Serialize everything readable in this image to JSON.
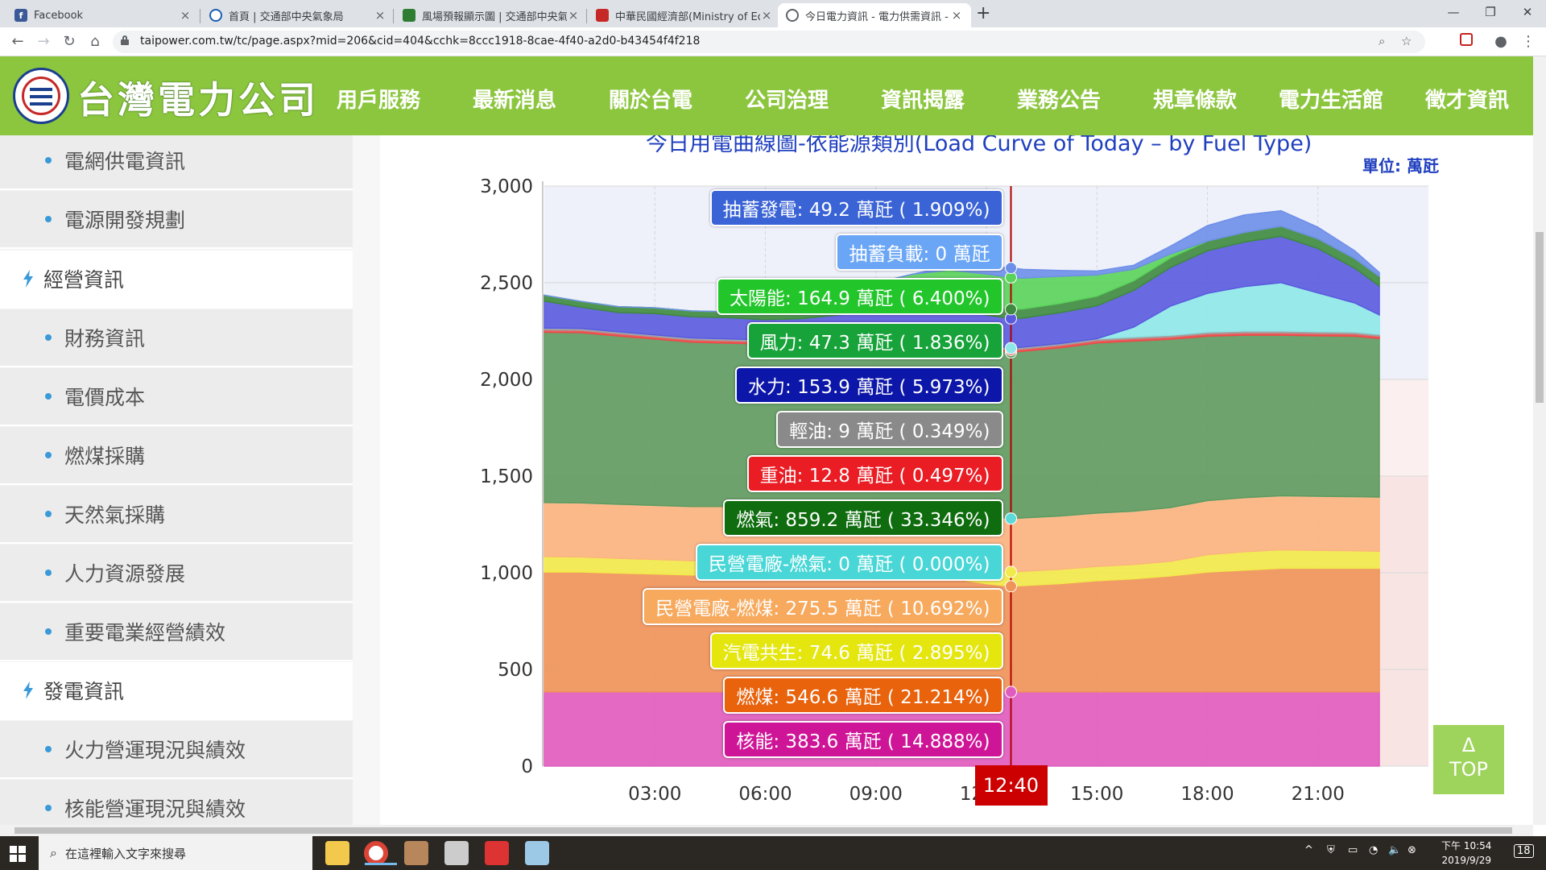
{
  "browser": {
    "tabs": [
      {
        "title": "Facebook",
        "icon": "facebook-icon",
        "color": "#3b5998"
      },
      {
        "title": "首頁 | 交通部中央氣象局",
        "icon": "eye-icon",
        "color": "#1a5fb4"
      },
      {
        "title": "風場預報顯示圖 | 交通部中央氣象",
        "icon": "weather-map-icon",
        "color": "#2e7d32"
      },
      {
        "title": "中華民國經濟部(Ministry of Econ",
        "icon": "moea-icon",
        "color": "#c62828"
      },
      {
        "title": "今日電力資訊 - 電力供需資訊 - 台",
        "icon": "site-icon",
        "color": "#5f6368"
      }
    ],
    "close_glyph": "×",
    "new_tab_glyph": "+",
    "url": "taipower.com.tw/tc/page.aspx?mid=206&cid=404&cchk=8ccc1918-8cae-4f40-a2d0-b43454f4f218"
  },
  "site": {
    "logo_text": "台灣電力公司",
    "nav": [
      "用戶服務",
      "最新消息",
      "關於台電",
      "公司治理",
      "資訊揭露",
      "業務公告",
      "規章條款",
      "電力生活館",
      "徵才資訊"
    ],
    "brand_color": "#8cc63f"
  },
  "sidebar": {
    "items": [
      {
        "label": "電網供電資訊",
        "kind": "sub"
      },
      {
        "label": "電源開發規劃",
        "kind": "sub"
      },
      {
        "label": "經營資訊",
        "kind": "cat"
      },
      {
        "label": "財務資訊",
        "kind": "sub"
      },
      {
        "label": "電價成本",
        "kind": "sub"
      },
      {
        "label": "燃煤採購",
        "kind": "sub"
      },
      {
        "label": "天然氣採購",
        "kind": "sub"
      },
      {
        "label": "人力資源發展",
        "kind": "sub"
      },
      {
        "label": "重要電業經營績效",
        "kind": "sub"
      },
      {
        "label": "發電資訊",
        "kind": "cat"
      },
      {
        "label": "火力營運現況與績效",
        "kind": "sub"
      },
      {
        "label": "核能營運現況與績效",
        "kind": "sub"
      }
    ]
  },
  "chart_data": {
    "type": "area",
    "title": "今日用電曲線圖-依能源類別(Load Curve of Today – by Fuel Type)",
    "unit": "單位: 萬瓩",
    "yticks": [
      "3,000",
      "2,500",
      "2,000",
      "1,500",
      "1,000",
      "500",
      "0"
    ],
    "xticks": [
      "03:00",
      "06:00",
      "09:00",
      "12:00",
      "15:00",
      "18:00",
      "21:00"
    ],
    "ylim": [
      0,
      3000
    ],
    "x": [
      "00:00",
      "01:00",
      "02:00",
      "03:00",
      "04:00",
      "05:00",
      "06:00",
      "07:00",
      "08:00",
      "09:00",
      "10:00",
      "11:00",
      "12:00",
      "12:40",
      "13:00",
      "14:00",
      "15:00",
      "16:00",
      "17:00",
      "18:00",
      "19:00",
      "20:00",
      "21:00",
      "22:00",
      "22:40"
    ],
    "current_time": "12:40",
    "series": [
      {
        "name": "核能",
        "color": "#e05bbf",
        "values": [
          383.6,
          383.6,
          383.6,
          383.6,
          383.6,
          383.6,
          383.6,
          383.6,
          383.6,
          383.6,
          383.6,
          383.6,
          383.6,
          383.6,
          383.6,
          383.6,
          383.6,
          383.6,
          383.6,
          383.6,
          383.6,
          383.6,
          383.6,
          383.6,
          383.6
        ]
      },
      {
        "name": "燃煤",
        "color": "#ef9359",
        "values": [
          620,
          620,
          615,
          610,
          605,
          605,
          605,
          605,
          605,
          605,
          600,
          590,
          560,
          546.6,
          550,
          560,
          575,
          585,
          600,
          620,
          630,
          640,
          640,
          640,
          640
        ]
      },
      {
        "name": "汽電共生",
        "color": "#f2ea4a",
        "values": [
          80,
          78,
          76,
          75,
          74,
          74,
          74,
          74,
          74,
          74,
          74,
          74,
          75,
          74.6,
          74,
          74,
          74,
          74,
          76,
          90,
          95,
          95,
          92,
          90,
          88
        ]
      },
      {
        "name": "民營電廠-燃煤",
        "color": "#fbb47f",
        "values": [
          280,
          280,
          280,
          280,
          280,
          280,
          280,
          280,
          280,
          280,
          280,
          280,
          278,
          275.5,
          276,
          276,
          276,
          276,
          278,
          280,
          280,
          280,
          280,
          280,
          280
        ]
      },
      {
        "name": "民營電廠-燃氣",
        "color": "#5ed9d9",
        "values": [
          0,
          0,
          0,
          0,
          0,
          0,
          0,
          0,
          0,
          0,
          0,
          0,
          0,
          0,
          0,
          0,
          0,
          0,
          0,
          0,
          0,
          0,
          0,
          0,
          0
        ]
      },
      {
        "name": "燃氣",
        "color": "#5e9a5e",
        "values": [
          880,
          880,
          870,
          860,
          850,
          845,
          840,
          840,
          850,
          860,
          865,
          862,
          860,
          859.2,
          862,
          870,
          880,
          880,
          870,
          850,
          840,
          830,
          830,
          830,
          820
        ]
      },
      {
        "name": "重油",
        "color": "#ee4a4a",
        "values": [
          12.8,
          12.8,
          12.8,
          12.8,
          12.8,
          12.8,
          12.8,
          12.8,
          12.8,
          12.8,
          12.8,
          12.8,
          12.8,
          12.8,
          12.8,
          12.8,
          12.8,
          12.8,
          12.8,
          12.8,
          12.8,
          12.8,
          12.8,
          12.8,
          12.8
        ]
      },
      {
        "name": "輕油",
        "color": "#a0a0a0",
        "values": [
          9,
          9,
          9,
          9,
          9,
          9,
          9,
          9,
          9,
          9,
          9,
          9,
          9,
          9,
          9,
          9,
          9,
          9,
          9,
          9,
          9,
          9,
          9,
          9,
          9
        ]
      },
      {
        "name": "水力",
        "color": "#8ee8e8",
        "values": [
          0,
          0,
          0,
          0,
          0,
          0,
          0,
          0,
          0,
          0,
          0,
          0,
          0,
          0,
          0,
          0,
          0,
          50,
          150,
          200,
          230,
          250,
          200,
          150,
          100
        ]
      },
      {
        "name": "水力(調度)",
        "color": "#5a5adf",
        "values": [
          140,
          110,
          100,
          110,
          110,
          110,
          105,
          110,
          120,
          130,
          140,
          150,
          155,
          153.9,
          150,
          160,
          170,
          190,
          200,
          220,
          230,
          240,
          230,
          180,
          150
        ]
      },
      {
        "name": "風力",
        "color": "#3e8a3e",
        "values": [
          30,
          30,
          30,
          30,
          30,
          30,
          30,
          30,
          32,
          35,
          40,
          45,
          47,
          47.3,
          47,
          48,
          50,
          50,
          50,
          50,
          50,
          52,
          50,
          50,
          50
        ]
      },
      {
        "name": "太陽能",
        "color": "#5ad35a",
        "values": [
          0,
          0,
          0,
          0,
          0,
          0,
          5,
          30,
          70,
          110,
          140,
          160,
          165,
          164.9,
          160,
          140,
          110,
          60,
          20,
          0,
          0,
          0,
          0,
          0,
          0
        ]
      },
      {
        "name": "抽蓄發電",
        "color": "#6e8fe8",
        "values": [
          0,
          0,
          0,
          0,
          0,
          0,
          0,
          0,
          0,
          0,
          0,
          20,
          40,
          49.2,
          45,
          30,
          20,
          20,
          40,
          80,
          90,
          80,
          60,
          40,
          20
        ]
      }
    ],
    "tooltips": [
      {
        "label": "抽蓄發電: 49.2 萬瓩 ( 1.909%)",
        "color": "#3a63d6"
      },
      {
        "label": "抽蓄負載: 0 萬瓩",
        "color": "#6aa6f5"
      },
      {
        "label": "太陽能: 164.9 萬瓩 ( 6.400%)",
        "color": "#22c62a"
      },
      {
        "label": "風力: 47.3 萬瓩 ( 1.836%)",
        "color": "#17a33a"
      },
      {
        "label": "水力: 153.9 萬瓩 ( 5.973%)",
        "color": "#0c16a8"
      },
      {
        "label": "輕油: 9 萬瓩 ( 0.349%)",
        "color": "#8a8a8a"
      },
      {
        "label": "重油: 12.8 萬瓩 ( 0.497%)",
        "color": "#ea1c24"
      },
      {
        "label": "燃氣: 859.2 萬瓩 ( 33.346%)",
        "color": "#0f6d0f"
      },
      {
        "label": "民營電廠-燃氣: 0 萬瓩 ( 0.000%)",
        "color": "#49d6d6"
      },
      {
        "label": "民營電廠-燃煤: 275.5 萬瓩 ( 10.692%)",
        "color": "#f7a95d"
      },
      {
        "label": "汽電共生: 74.6 萬瓩 ( 2.895%)",
        "color": "#e4e60e"
      },
      {
        "label": "燃煤: 546.6 萬瓩 ( 21.214%)",
        "color": "#e9620c"
      },
      {
        "label": "核能: 383.6 萬瓩 ( 14.888%)",
        "color": "#cf1597"
      }
    ]
  },
  "top_button": {
    "arrow": "Δ",
    "label": "TOP"
  },
  "taskbar": {
    "search_placeholder": "在這裡輸入文字來搜尋",
    "time": "下午 10:54",
    "date": "2019/9/29",
    "notifications": "18"
  }
}
